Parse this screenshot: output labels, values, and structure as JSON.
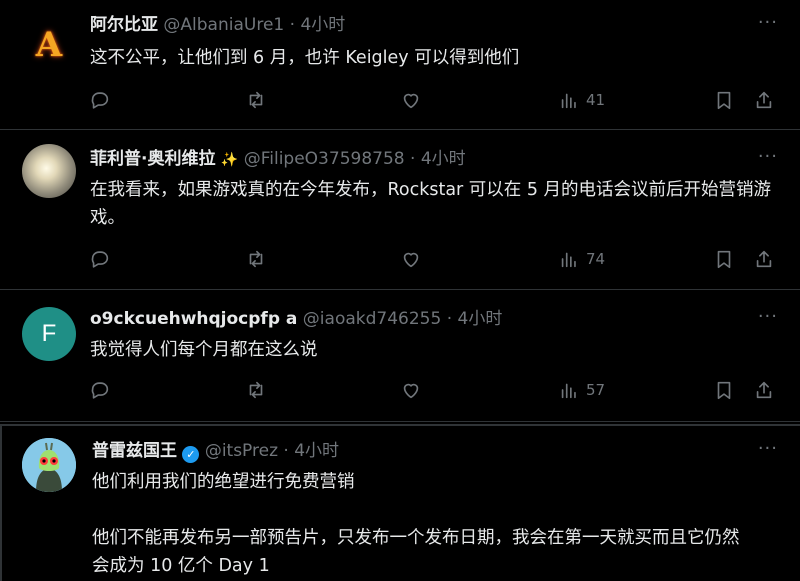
{
  "tweets": [
    {
      "name": "阿尔比亚",
      "handle": "@AlbaniaUre1",
      "time": "4小时",
      "avatar_letter": "A",
      "text": "这不公平，让他们到 6 月，也许 Keigley 可以得到他们",
      "views": "41"
    },
    {
      "name": "菲利普·奥利维拉",
      "handle": "@FilipeO37598758",
      "time": "4小时",
      "badge_emoji": "✨",
      "text": "在我看来，如果游戏真的在今年发布，Rockstar 可以在 5 月的电话会议前后开始营销游戏。",
      "views": "74"
    },
    {
      "name": "o9ckcuehwhqjocpfp a",
      "handle": "@iaoakd746255",
      "time": "4小时",
      "avatar_letter": "F",
      "text": "我觉得人们每个月都在这么说",
      "views": "57"
    },
    {
      "name": "普雷兹国王",
      "handle": "@itsPrez",
      "time": "4小时",
      "verified": true,
      "text": "他们利用我们的绝望进行免费营销\n\n他们不能再发布另一部预告片，只发布一个发布日期，我会在第一天就买而且它仍然会成为 10 亿个 Day 1"
    }
  ],
  "separator": "·",
  "more_label": "···",
  "colors": {
    "background": "#000000",
    "text": "#e7e9ea",
    "muted": "#71767b",
    "divider": "#2f3336",
    "verified": "#1d9bf0",
    "avatar_teal": "#1f8f86"
  }
}
